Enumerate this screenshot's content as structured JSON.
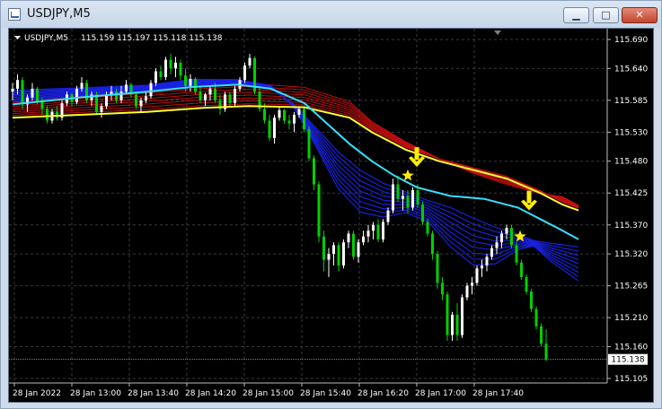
{
  "window": {
    "title": "USDJPY,M5",
    "min_glyph": "▁",
    "max_glyph": "□",
    "close_glyph": "✕"
  },
  "chart_header": {
    "symbol": "USDJPY,M5",
    "ohlc": "115.159 115.197 115.118 115.138"
  },
  "current_price": "115.138",
  "colors": {
    "background": "#000000",
    "grid": "#3a3a3a",
    "bull": "#ffffff",
    "bear": "#00d000",
    "yellow_ma": "#ffff33",
    "cyan_ma": "#33e0ff",
    "red_band": "#d01010",
    "blue_band": "#1a22e8",
    "arrow": "#ffee00",
    "star": "#ffee00"
  },
  "chart_data": {
    "type": "candlestick",
    "y_ticks": [
      "115.690",
      "115.640",
      "115.585",
      "115.530",
      "115.480",
      "115.425",
      "115.370",
      "115.320",
      "115.265",
      "115.210",
      "115.160",
      "115.105"
    ],
    "y_range": [
      115.105,
      115.69
    ],
    "x_ticks": [
      "28 Jan 2022",
      "28 Jan 13:00",
      "28 Jan 13:40",
      "28 Jan 14:20",
      "28 Jan 15:00",
      "28 Jan 15:40",
      "28 Jan 16:20",
      "28 Jan 17:00",
      "28 Jan 17:40"
    ],
    "grid": true,
    "candles": [
      [
        115.6,
        115.615,
        115.585,
        115.605
      ],
      [
        115.605,
        115.63,
        115.595,
        115.62
      ],
      [
        115.62,
        115.625,
        115.57,
        115.578
      ],
      [
        115.578,
        115.595,
        115.565,
        115.59
      ],
      [
        115.59,
        115.615,
        115.585,
        115.605
      ],
      [
        115.605,
        115.608,
        115.578,
        115.582
      ],
      [
        115.582,
        115.59,
        115.56,
        115.57
      ],
      [
        115.57,
        115.575,
        115.545,
        115.55
      ],
      [
        115.55,
        115.57,
        115.545,
        115.565
      ],
      [
        115.565,
        115.575,
        115.55,
        115.555
      ],
      [
        115.555,
        115.585,
        115.55,
        115.58
      ],
      [
        115.58,
        115.6,
        115.575,
        115.595
      ],
      [
        115.595,
        115.598,
        115.575,
        115.582
      ],
      [
        115.582,
        115.61,
        115.578,
        115.605
      ],
      [
        115.605,
        115.625,
        115.6,
        115.615
      ],
      [
        115.615,
        115.62,
        115.58,
        115.585
      ],
      [
        115.585,
        115.6,
        115.575,
        115.595
      ],
      [
        115.595,
        115.6,
        115.56,
        115.565
      ],
      [
        115.565,
        115.58,
        115.555,
        115.575
      ],
      [
        115.575,
        115.6,
        115.57,
        115.595
      ],
      [
        115.595,
        115.61,
        115.585,
        115.6
      ],
      [
        115.6,
        115.605,
        115.58,
        115.585
      ],
      [
        115.585,
        115.61,
        115.58,
        115.6
      ],
      [
        115.6,
        115.62,
        115.595,
        115.612
      ],
      [
        115.612,
        115.615,
        115.59,
        115.595
      ],
      [
        115.595,
        115.6,
        115.57,
        115.575
      ],
      [
        115.575,
        115.59,
        115.565,
        115.585
      ],
      [
        115.585,
        115.6,
        115.58,
        115.592
      ],
      [
        115.592,
        115.62,
        115.588,
        115.615
      ],
      [
        115.615,
        115.64,
        115.61,
        115.635
      ],
      [
        115.635,
        115.645,
        115.62,
        115.625
      ],
      [
        115.625,
        115.66,
        115.62,
        115.655
      ],
      [
        115.655,
        115.665,
        115.63,
        115.64
      ],
      [
        115.64,
        115.66,
        115.625,
        115.65
      ],
      [
        115.65,
        115.655,
        115.62,
        115.628
      ],
      [
        115.628,
        115.64,
        115.6,
        115.61
      ],
      [
        115.61,
        115.63,
        115.6,
        115.622
      ],
      [
        115.622,
        115.625,
        115.595,
        115.6
      ],
      [
        115.6,
        115.61,
        115.58,
        115.585
      ],
      [
        115.585,
        115.598,
        115.575,
        115.595
      ],
      [
        115.595,
        115.61,
        115.585,
        115.605
      ],
      [
        115.605,
        115.615,
        115.58,
        115.585
      ],
      [
        115.585,
        115.595,
        115.56,
        115.57
      ],
      [
        115.57,
        115.6,
        115.565,
        115.595
      ],
      [
        115.595,
        115.6,
        115.575,
        115.58
      ],
      [
        115.58,
        115.61,
        115.575,
        115.605
      ],
      [
        115.605,
        115.625,
        115.6,
        115.62
      ],
      [
        115.62,
        115.65,
        115.615,
        115.645
      ],
      [
        115.645,
        115.665,
        115.64,
        115.658
      ],
      [
        115.658,
        115.66,
        115.595,
        115.6
      ],
      [
        115.6,
        115.61,
        115.565,
        115.57
      ],
      [
        115.57,
        115.58,
        115.545,
        115.55
      ],
      [
        115.55,
        115.56,
        115.515,
        115.52
      ],
      [
        115.52,
        115.56,
        115.51,
        115.555
      ],
      [
        115.555,
        115.575,
        115.55,
        115.568
      ],
      [
        115.568,
        115.57,
        115.545,
        115.55
      ],
      [
        115.55,
        115.56,
        115.535,
        115.545
      ],
      [
        115.545,
        115.565,
        115.53,
        115.56
      ],
      [
        115.56,
        115.575,
        115.555,
        115.57
      ],
      [
        115.57,
        115.575,
        115.53,
        115.535
      ],
      [
        115.535,
        115.54,
        115.48,
        115.485
      ],
      [
        115.485,
        115.49,
        115.43,
        115.44
      ],
      [
        115.44,
        115.445,
        115.34,
        115.35
      ],
      [
        115.35,
        115.36,
        115.29,
        115.31
      ],
      [
        115.31,
        115.33,
        115.28,
        115.32
      ],
      [
        115.32,
        115.34,
        115.3,
        115.335
      ],
      [
        115.335,
        115.34,
        115.29,
        115.3
      ],
      [
        115.3,
        115.345,
        115.295,
        115.34
      ],
      [
        115.34,
        115.36,
        115.33,
        115.355
      ],
      [
        115.355,
        115.36,
        115.31,
        115.315
      ],
      [
        115.315,
        115.345,
        115.305,
        115.34
      ],
      [
        115.34,
        115.36,
        115.335,
        115.35
      ],
      [
        115.35,
        115.37,
        115.34,
        115.36
      ],
      [
        115.36,
        115.375,
        115.345,
        115.37
      ],
      [
        115.37,
        115.38,
        115.34,
        115.345
      ],
      [
        115.345,
        115.38,
        115.34,
        115.375
      ],
      [
        115.375,
        115.4,
        115.37,
        115.395
      ],
      [
        115.395,
        115.45,
        115.39,
        115.44
      ],
      [
        115.44,
        115.455,
        115.41,
        115.415
      ],
      [
        115.415,
        115.43,
        115.395,
        115.42
      ],
      [
        115.42,
        115.43,
        115.39,
        115.4
      ],
      [
        115.4,
        115.435,
        115.395,
        115.43
      ],
      [
        115.43,
        115.44,
        115.4,
        115.405
      ],
      [
        115.405,
        115.41,
        115.37,
        115.375
      ],
      [
        115.375,
        115.38,
        115.35,
        115.355
      ],
      [
        115.355,
        115.36,
        115.31,
        115.32
      ],
      [
        115.32,
        115.325,
        115.26,
        115.27
      ],
      [
        115.27,
        115.28,
        115.24,
        115.25
      ],
      [
        115.25,
        115.255,
        115.17,
        115.18
      ],
      [
        115.18,
        115.22,
        115.17,
        115.215
      ],
      [
        115.215,
        115.235,
        115.17,
        115.18
      ],
      [
        115.18,
        115.25,
        115.175,
        115.245
      ],
      [
        115.245,
        115.27,
        115.24,
        115.265
      ],
      [
        115.265,
        115.28,
        115.25,
        115.27
      ],
      [
        115.27,
        115.3,
        115.265,
        115.295
      ],
      [
        115.295,
        115.31,
        115.28,
        115.3
      ],
      [
        115.3,
        115.32,
        115.29,
        115.315
      ],
      [
        115.315,
        115.335,
        115.31,
        115.33
      ],
      [
        115.33,
        115.35,
        115.32,
        115.34
      ],
      [
        115.34,
        115.36,
        115.33,
        115.355
      ],
      [
        115.355,
        115.37,
        115.345,
        115.365
      ],
      [
        115.365,
        115.37,
        115.33,
        115.335
      ],
      [
        115.335,
        115.34,
        115.3,
        115.305
      ],
      [
        115.305,
        115.31,
        115.275,
        115.28
      ],
      [
        115.28,
        115.285,
        115.25,
        115.255
      ],
      [
        115.255,
        115.26,
        115.22,
        115.225
      ],
      [
        115.225,
        115.23,
        115.19,
        115.195
      ],
      [
        115.195,
        115.2,
        115.16,
        115.165
      ],
      [
        115.165,
        115.19,
        115.135,
        115.138
      ]
    ],
    "ma_curves": [
      {
        "color": "yellow",
        "points": [
          [
            0,
            115.555
          ],
          [
            30,
            115.56
          ],
          [
            60,
            115.565
          ],
          [
            85,
            115.572
          ],
          [
            105,
            115.575
          ],
          [
            130,
            115.573
          ],
          [
            150,
            115.555
          ],
          [
            160,
            115.53
          ],
          [
            175,
            115.5
          ],
          [
            190,
            115.48
          ],
          [
            205,
            115.465
          ],
          [
            220,
            115.45
          ],
          [
            235,
            115.425
          ],
          [
            245,
            115.405
          ],
          [
            252,
            115.395
          ]
        ]
      },
      {
        "color": "cyan",
        "points": [
          [
            0,
            115.578
          ],
          [
            30,
            115.59
          ],
          [
            60,
            115.6
          ],
          [
            80,
            115.608
          ],
          [
            100,
            115.612
          ],
          [
            115,
            115.605
          ],
          [
            130,
            115.58
          ],
          [
            140,
            115.545
          ],
          [
            150,
            115.51
          ],
          [
            160,
            115.48
          ],
          [
            170,
            115.455
          ],
          [
            180,
            115.435
          ],
          [
            195,
            115.42
          ],
          [
            210,
            115.415
          ],
          [
            225,
            115.4
          ],
          [
            235,
            115.38
          ],
          [
            245,
            115.36
          ],
          [
            252,
            115.345
          ]
        ]
      },
      {
        "color": "blue",
        "points": [
          [
            0,
            115.6
          ],
          [
            30,
            115.605
          ],
          [
            60,
            115.61
          ],
          [
            80,
            115.62
          ],
          [
            100,
            115.62
          ],
          [
            115,
            115.61
          ],
          [
            125,
            115.575
          ],
          [
            135,
            115.51
          ],
          [
            145,
            115.44
          ],
          [
            155,
            115.4
          ],
          [
            165,
            115.39
          ],
          [
            175,
            115.395
          ],
          [
            185,
            115.38
          ],
          [
            195,
            115.34
          ],
          [
            205,
            115.31
          ],
          [
            215,
            115.31
          ],
          [
            225,
            115.33
          ],
          [
            232,
            115.335
          ],
          [
            240,
            115.31
          ],
          [
            252,
            115.28
          ]
        ]
      }
    ],
    "arrows": [
      {
        "x": 180,
        "y": 115.47
      },
      {
        "x": 230,
        "y": 115.395
      }
    ],
    "stars": [
      {
        "x": 176,
        "y": 115.455
      },
      {
        "x": 226,
        "y": 115.35
      }
    ]
  }
}
